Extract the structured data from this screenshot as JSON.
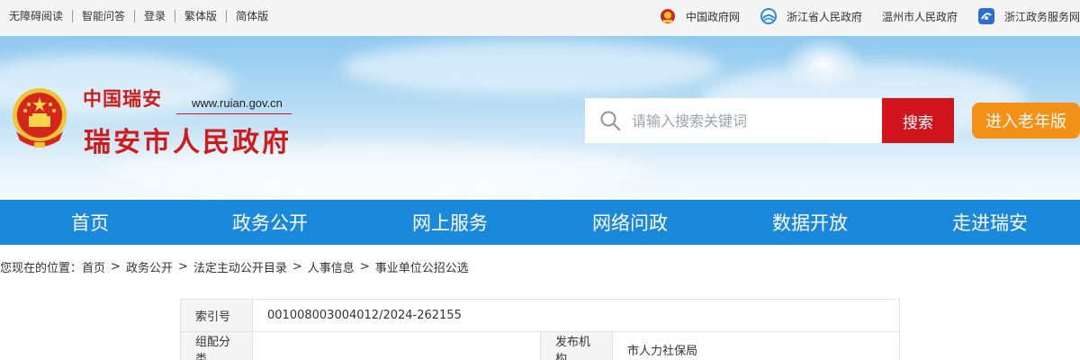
{
  "topbar": {
    "left_links": [
      "无障碍阅读",
      "智能问答",
      "登录",
      "繁体版",
      "简体版"
    ],
    "right_links": [
      {
        "label": "中国政府网",
        "icon": "national-emblem-icon"
      },
      {
        "label": "浙江省人民政府",
        "icon": "zhejiang-logo-icon"
      },
      {
        "label": "温州市人民政府",
        "icon": ""
      },
      {
        "label": "浙江政务服务网",
        "icon": "zwfw-logo-icon"
      }
    ]
  },
  "header": {
    "logo_top": "中国瑞安",
    "logo_url": "www.ruian.gov.cn",
    "logo_name": "瑞安市人民政府",
    "search_placeholder": "请输入搜索关键词",
    "search_button": "搜索",
    "elder_button": "进入老年版"
  },
  "nav": [
    "首页",
    "政务公开",
    "网上服务",
    "网络问政",
    "数据开放",
    "走进瑞安"
  ],
  "breadcrumb": {
    "prefix": "您现在的位置：",
    "items": [
      "首页",
      "政务公开",
      "法定主动公开目录",
      "人事信息",
      "事业单位公招公选"
    ],
    "separator": ">"
  },
  "info_table": {
    "row1": {
      "label": "索引号",
      "value": "001008003004012/2024-262155"
    },
    "row2": {
      "label": "组配分类",
      "value": "",
      "label2": "发布机构",
      "value2": "市人力社保局"
    }
  },
  "colors": {
    "brand_red": "#d11b1b",
    "nav_blue": "#1a89dc",
    "search_red": "#d2141f",
    "elder_orange": "#f39016"
  }
}
